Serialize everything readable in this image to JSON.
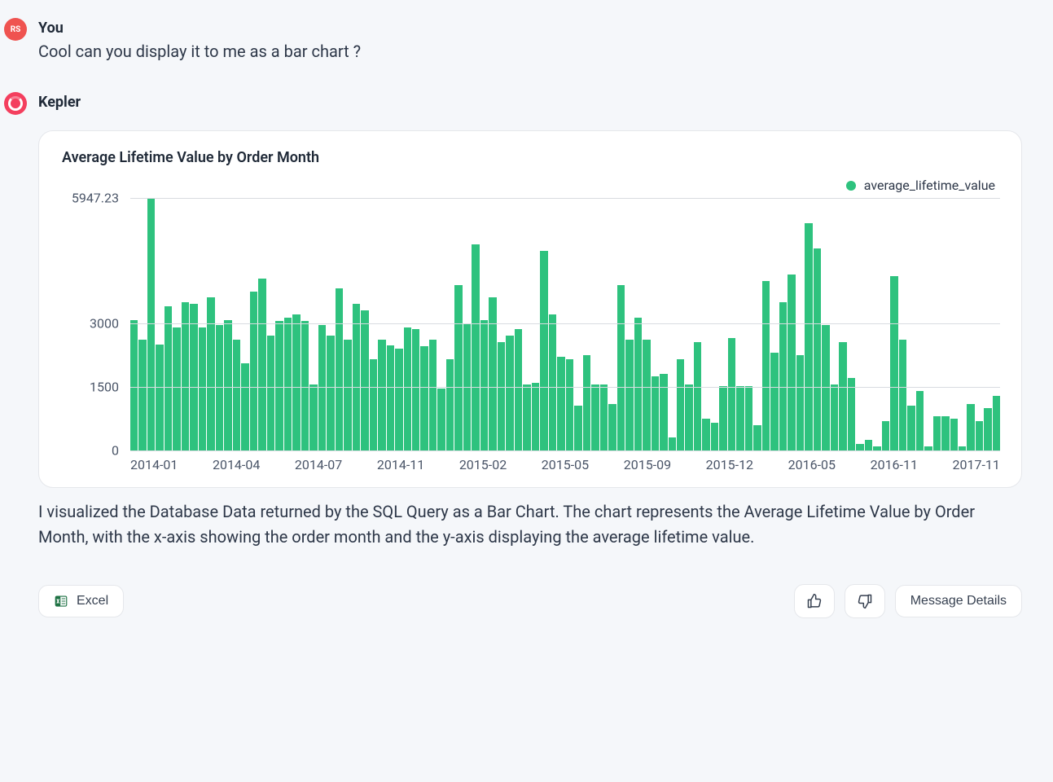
{
  "user": {
    "name": "You",
    "initials": "RS",
    "message": "Cool can you display it to me as a bar chart ?"
  },
  "assistant": {
    "name": "Kepler",
    "description": "I visualized the Database Data returned by the SQL Query as a Bar Chart. The chart represents the Average Lifetime Value by Order Month, with the x-axis showing the order month and the y-axis displaying the average lifetime value."
  },
  "actions": {
    "excel": "Excel",
    "details": "Message Details"
  },
  "chart_data": {
    "type": "bar",
    "title": "Average Lifetime Value by Order Month",
    "legend": "average_lifetime_value",
    "ylabel": "",
    "xlabel": "",
    "ylim": [
      0,
      5947.23
    ],
    "yticks": [
      0,
      1500,
      3000,
      5947.23
    ],
    "xticks": [
      "2014-01",
      "2014-04",
      "2014-07",
      "2014-11",
      "2015-02",
      "2015-05",
      "2015-09",
      "2015-12",
      "2016-05",
      "2016-11",
      "2017-11"
    ],
    "categories": [
      "2014-01",
      "2014-01",
      "2014-02",
      "2014-02",
      "2014-03",
      "2014-03",
      "2014-03",
      "2014-04",
      "2014-04",
      "2014-04",
      "2014-05",
      "2014-05",
      "2014-05",
      "2014-06",
      "2014-06",
      "2014-06",
      "2014-07",
      "2014-07",
      "2014-08",
      "2014-08",
      "2014-08",
      "2014-09",
      "2014-09",
      "2014-09",
      "2014-10",
      "2014-10",
      "2014-10",
      "2014-11",
      "2014-11",
      "2014-11",
      "2014-12",
      "2014-12",
      "2014-12",
      "2015-01",
      "2015-01",
      "2015-01",
      "2015-02",
      "2015-02",
      "2015-02",
      "2015-03",
      "2015-03",
      "2015-03",
      "2015-04",
      "2015-04",
      "2015-04",
      "2015-05",
      "2015-05",
      "2015-05",
      "2015-06",
      "2015-06",
      "2015-06",
      "2015-07",
      "2015-07",
      "2015-07",
      "2015-08",
      "2015-08",
      "2015-08",
      "2015-09",
      "2015-09",
      "2015-09",
      "2015-10",
      "2015-10",
      "2015-10",
      "2015-11",
      "2015-11",
      "2015-11",
      "2015-12",
      "2015-12",
      "2015-12",
      "2016-01",
      "2016-01",
      "2016-02",
      "2016-02",
      "2016-03",
      "2016-03",
      "2016-04",
      "2016-05",
      "2016-05",
      "2016-06",
      "2016-06",
      "2016-07",
      "2016-07",
      "2016-08",
      "2016-09",
      "2016-10",
      "2016-10",
      "2016-11",
      "2016-11",
      "2016-12",
      "2017-01",
      "2017-02",
      "2017-03",
      "2017-04",
      "2017-04",
      "2017-05",
      "2017-06",
      "2017-07",
      "2017-08",
      "2017-09",
      "2017-10",
      "2017-11",
      "2017-11"
    ],
    "values": [
      3070,
      2600,
      5947.23,
      2500,
      3400,
      2900,
      3500,
      3450,
      2900,
      3600,
      2950,
      3070,
      2600,
      2050,
      3750,
      4050,
      2700,
      3050,
      3120,
      3200,
      3050,
      1550,
      2950,
      2700,
      3820,
      2600,
      3450,
      3300,
      2150,
      2600,
      2480,
      2400,
      2900,
      2850,
      2450,
      2600,
      1450,
      2150,
      3900,
      3000,
      4850,
      3070,
      3600,
      2550,
      2700,
      2850,
      1550,
      1600,
      4700,
      3200,
      2200,
      2150,
      1050,
      2250,
      1550,
      1550,
      1100,
      3900,
      2600,
      3120,
      2600,
      1750,
      1800,
      300,
      2150,
      1550,
      2550,
      750,
      650,
      1520,
      2650,
      1520,
      1520,
      600,
      4000,
      2300,
      3500,
      4150,
      2250,
      5350,
      4750,
      2950,
      1550,
      2550,
      1700,
      150,
      250,
      100,
      700,
      4100,
      2600,
      1050,
      1400,
      100,
      800,
      800,
      750,
      100,
      1100,
      700,
      1000,
      1280
    ]
  }
}
